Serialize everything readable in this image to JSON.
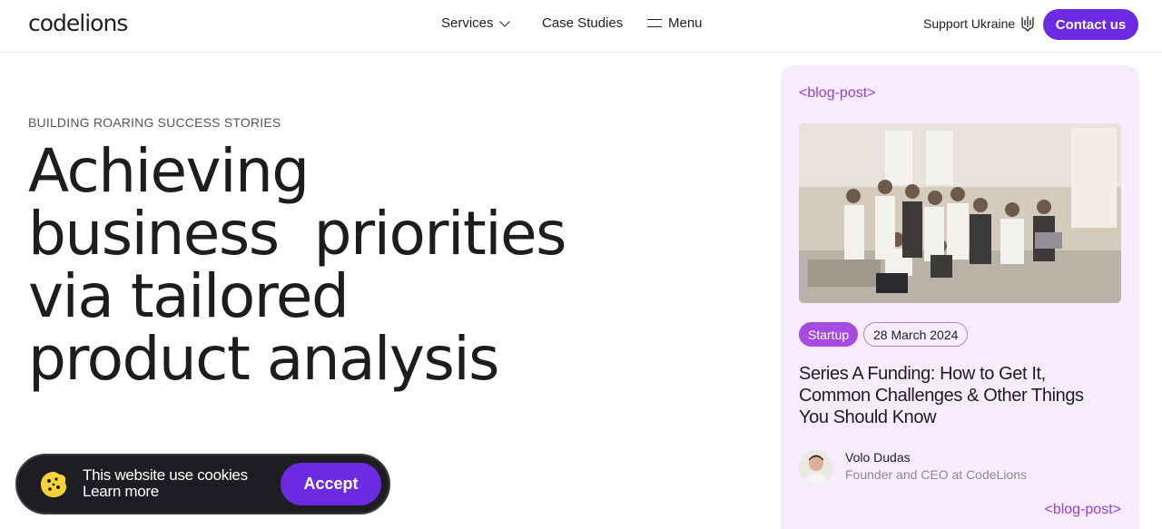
{
  "header": {
    "logo": "codelions",
    "nav": {
      "services": "Services",
      "case_studies": "Case Studies",
      "menu": "Menu"
    },
    "support": "Support Ukraine",
    "contact": "Contact us"
  },
  "hero": {
    "eyebrow": "BUILDING ROARING SUCCESS STORIES",
    "title_lines": [
      "Achieving",
      "business  priorities",
      "via tailored",
      "product analysis"
    ]
  },
  "cookie": {
    "line1": "This website use cookies",
    "line2": "Learn more",
    "accept": "Accept"
  },
  "blog": {
    "tag_open": "<blog-post>",
    "tag_close": "<blog-post>",
    "category": "Startup",
    "date": "28 March 2024",
    "title": "Series A Funding: How to Get It, Common Challenges & Other Things You Should Know",
    "author": {
      "name": "Volo Dudas",
      "role": "Founder and CEO at CodeLions"
    }
  },
  "colors": {
    "accent": "#6c2be2",
    "tag": "#9a3fd6",
    "card_bg": "#f7ecfd"
  },
  "icons": [
    "chevron-down-icon",
    "menu-icon",
    "trident-icon",
    "cookie-icon"
  ]
}
